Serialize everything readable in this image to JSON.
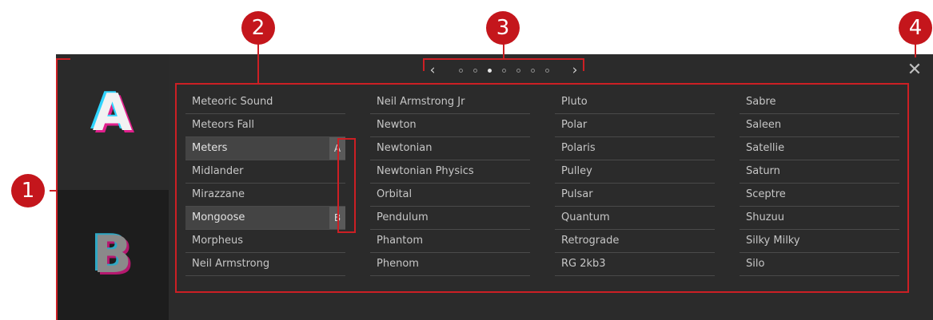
{
  "sidebar": {
    "slots": [
      {
        "letter": "A"
      },
      {
        "letter": "B"
      }
    ]
  },
  "pager": {
    "prev_icon": "‹",
    "next_icon": "›",
    "page_count": 7,
    "active_page": 3
  },
  "close_icon": "✕",
  "columns": [
    {
      "items": [
        {
          "label": "Meteoric Sound"
        },
        {
          "label": "Meteors Fall"
        },
        {
          "label": "Meters",
          "highlight": true,
          "tag": "A"
        },
        {
          "label": "Midlander"
        },
        {
          "label": "Mirazzane"
        },
        {
          "label": "Mongoose",
          "highlight": true,
          "tag": "B"
        },
        {
          "label": "Morpheus"
        },
        {
          "label": "Neil Armstrong"
        }
      ]
    },
    {
      "items": [
        {
          "label": "Neil Armstrong Jr"
        },
        {
          "label": "Newton"
        },
        {
          "label": "Newtonian"
        },
        {
          "label": "Newtonian Physics"
        },
        {
          "label": "Orbital"
        },
        {
          "label": "Pendulum"
        },
        {
          "label": "Phantom"
        },
        {
          "label": "Phenom"
        }
      ]
    },
    {
      "items": [
        {
          "label": "Pluto"
        },
        {
          "label": "Polar"
        },
        {
          "label": "Polaris"
        },
        {
          "label": "Pulley"
        },
        {
          "label": "Pulsar"
        },
        {
          "label": "Quantum"
        },
        {
          "label": "Retrograde"
        },
        {
          "label": "RG 2kb3"
        }
      ]
    },
    {
      "items": [
        {
          "label": "Sabre"
        },
        {
          "label": "Saleen"
        },
        {
          "label": "Satellie"
        },
        {
          "label": "Saturn"
        },
        {
          "label": "Sceptre"
        },
        {
          "label": "Shuzuu"
        },
        {
          "label": "Silky Milky"
        },
        {
          "label": "Silo"
        }
      ]
    }
  ],
  "callouts": {
    "c1": "1",
    "c2": "2",
    "c3": "3",
    "c4": "4"
  },
  "colors": {
    "annotation_red": "#cc1f24",
    "panel_bg": "#2b2b2b"
  }
}
